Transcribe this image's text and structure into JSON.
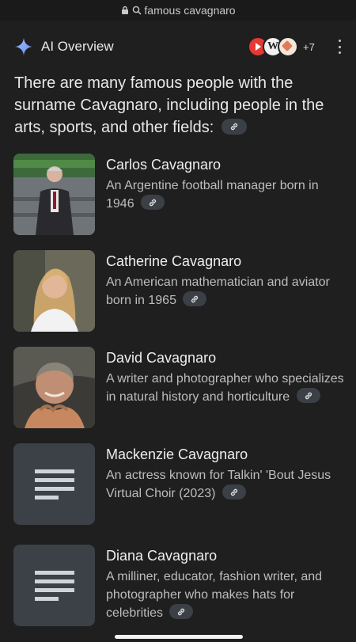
{
  "browser": {
    "url_text": "famous cavagnaro"
  },
  "overview": {
    "title": "AI Overview",
    "sources_more": "+7",
    "intro": "There are many famous people with the surname Cavagnaro, including people in the arts, sports, and other fields:"
  },
  "people": [
    {
      "name": "Carlos Cavagnaro",
      "description": "An Argentine football manager born in 1946",
      "thumb": "photo"
    },
    {
      "name": "Catherine Cavagnaro",
      "description": "An American mathematician and aviator born in 1965",
      "thumb": "photo"
    },
    {
      "name": "David Cavagnaro",
      "description": "A writer and photographer who specializes in natural history and horticulture",
      "thumb": "photo"
    },
    {
      "name": "Mackenzie Cavagnaro",
      "description": "An actress known for Talkin' 'Bout Jesus Virtual Choir (2023)",
      "thumb": "document"
    },
    {
      "name": "Diana Cavagnaro",
      "description": "A milliner, educator, fashion writer, and photographer who makes hats for celebrities",
      "thumb": "document"
    }
  ],
  "icons": {
    "lock": "lock-icon",
    "search": "search-icon",
    "sparkle": "sparkle-icon",
    "link": "link-icon",
    "menu": "more-vert-icon",
    "document": "document-icon"
  },
  "colors": {
    "background": "#1f1f1f",
    "chip": "#3b3f46",
    "sparkle": "#8ab4f8"
  }
}
